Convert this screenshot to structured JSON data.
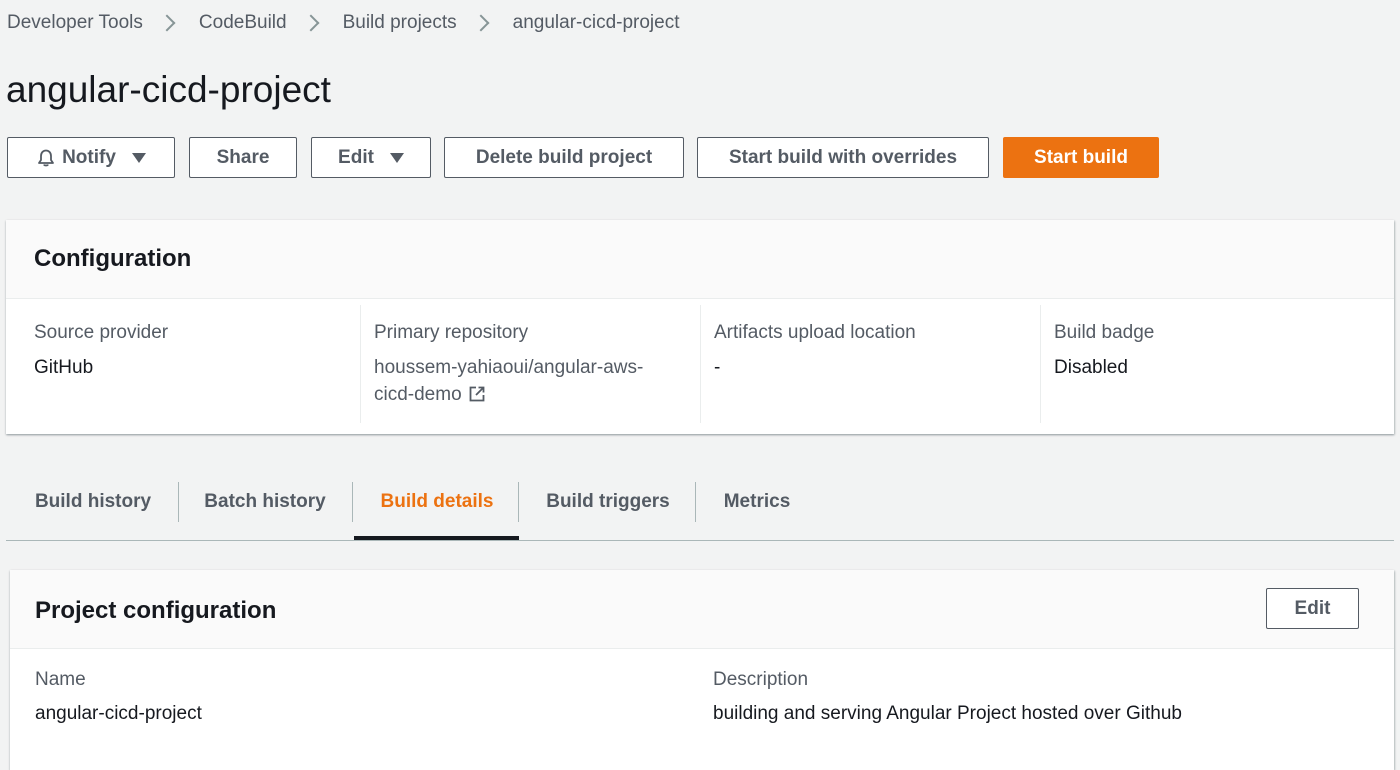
{
  "breadcrumb": {
    "items": [
      "Developer Tools",
      "CodeBuild",
      "Build projects",
      "angular-cicd-project"
    ]
  },
  "page": {
    "title": "angular-cicd-project"
  },
  "actions": {
    "notify": "Notify",
    "share": "Share",
    "edit": "Edit",
    "delete": "Delete build project",
    "start_overrides": "Start build with overrides",
    "start_build": "Start build"
  },
  "configuration": {
    "title": "Configuration",
    "fields": [
      {
        "label": "Source provider",
        "value": "GitHub"
      },
      {
        "label": "Primary repository",
        "value_line1": "houssem-yahiaoui/angular-aws-",
        "value_line2": "cicd-demo"
      },
      {
        "label": "Artifacts upload location",
        "value": "-"
      },
      {
        "label": "Build badge",
        "value": "Disabled"
      }
    ]
  },
  "tabs": [
    {
      "label": "Build history"
    },
    {
      "label": "Batch history"
    },
    {
      "label": "Build details",
      "active": true
    },
    {
      "label": "Build triggers"
    },
    {
      "label": "Metrics"
    }
  ],
  "project_configuration": {
    "title": "Project configuration",
    "edit": "Edit",
    "name_label": "Name",
    "name_value": "angular-cicd-project",
    "description_label": "Description",
    "description_value": "building and serving Angular Project hosted over Github"
  },
  "colors": {
    "accent": "#ec7211",
    "background": "#f2f3f3",
    "text": "#16191f",
    "muted": "#545b64"
  }
}
